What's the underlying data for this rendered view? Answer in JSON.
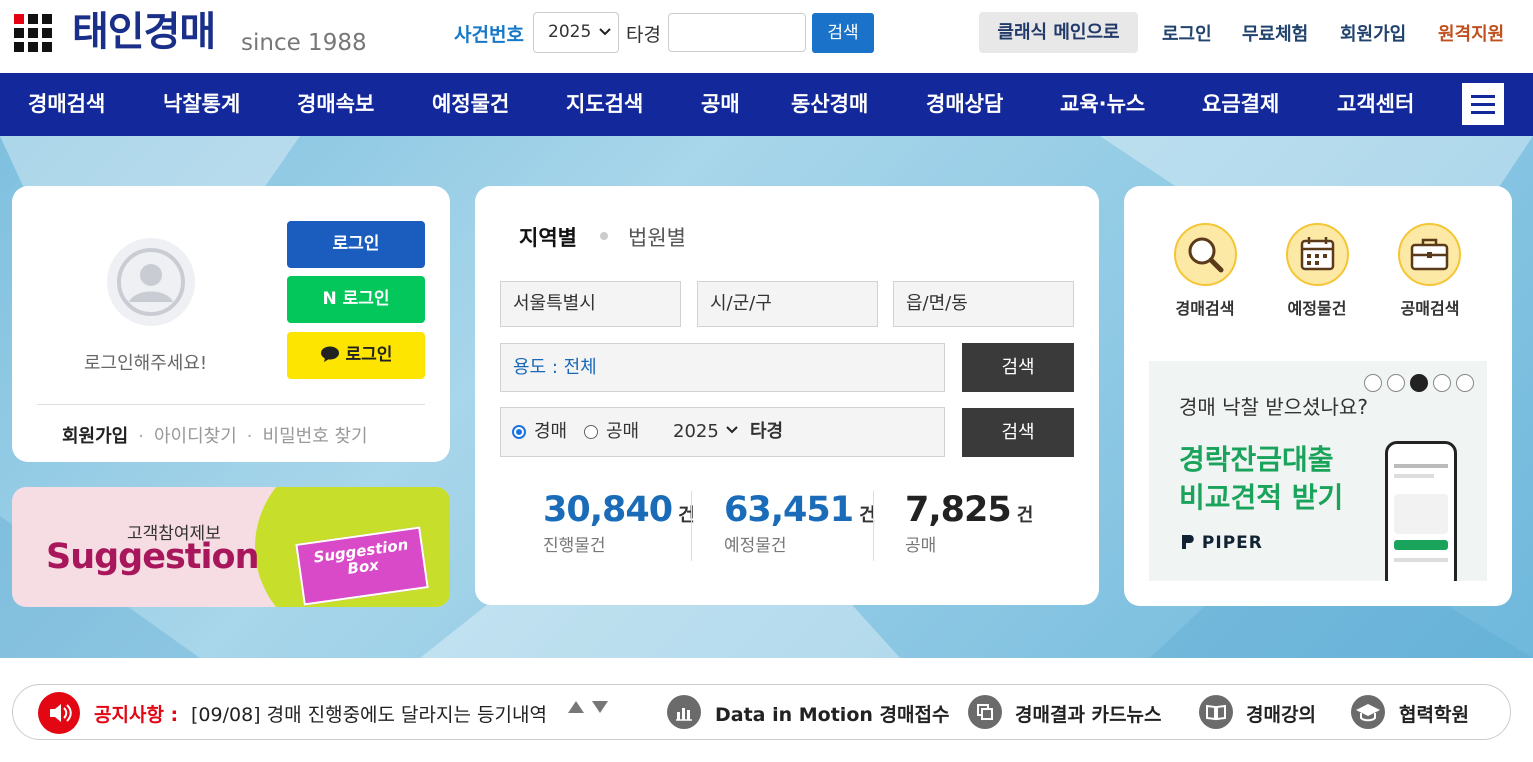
{
  "header": {
    "logo_text": "태인경매",
    "since": "since 1988",
    "case_label": "사건번호",
    "year_value": "2025",
    "tk_label": "타경",
    "search_button": "검색",
    "classic_button": "클래식 메인으로",
    "links": [
      "로그인",
      "무료체험",
      "회원가입",
      "원격지원"
    ]
  },
  "nav": {
    "items": [
      "경매검색",
      "낙찰통계",
      "경매속보",
      "예정물건",
      "지도검색",
      "공매",
      "동산경매",
      "경매상담",
      "교육·뉴스",
      "요금결제",
      "고객센터"
    ]
  },
  "login": {
    "prompt": "로그인해주세요!",
    "login_button": "로그인",
    "naver_button": "N 로그인",
    "kakao_button": "로그인",
    "signup": "회원가입",
    "find_id": "아이디찾기",
    "find_pw": "비밀번호 찾기"
  },
  "suggestion": {
    "kor": "고객참여제보",
    "eng": "Suggestion",
    "box_text": "Suggestion Box"
  },
  "search": {
    "tab_region": "지역별",
    "tab_court": "법원별",
    "city": "서울특별시",
    "district": "시/군/구",
    "town": "읍/면/동",
    "use": "용도 : 전체",
    "search_button": "검색",
    "radio_auction": "경매",
    "radio_public": "공매",
    "year": "2025",
    "tk": "타경",
    "stats": [
      {
        "num": "30,840",
        "unit": "건",
        "label": "진행물건",
        "color": "#1a6cb8"
      },
      {
        "num": "63,451",
        "unit": "건",
        "label": "예정물건",
        "color": "#1a6cb8"
      },
      {
        "num": "7,825",
        "unit": "건",
        "label": "공매",
        "color": "#222222"
      }
    ]
  },
  "quick": {
    "items": [
      {
        "label": "경매검색",
        "icon": "magnifier-icon"
      },
      {
        "label": "예정물건",
        "icon": "calendar-icon"
      },
      {
        "label": "공매검색",
        "icon": "briefcase-icon"
      }
    ],
    "ad": {
      "question": "경매 낙찰 받으셨나요?",
      "headline1": "경락잔금대출",
      "headline2": "비교견적 받기",
      "brand": "PIPER"
    }
  },
  "notice": {
    "label": "공지사항 :",
    "text": "[09/08] 경매 진행중에도 달라지는 등기내역",
    "links": [
      "Data in Motion 경매접수",
      "경매결과 카드뉴스",
      "경매강의",
      "협력학원"
    ]
  }
}
